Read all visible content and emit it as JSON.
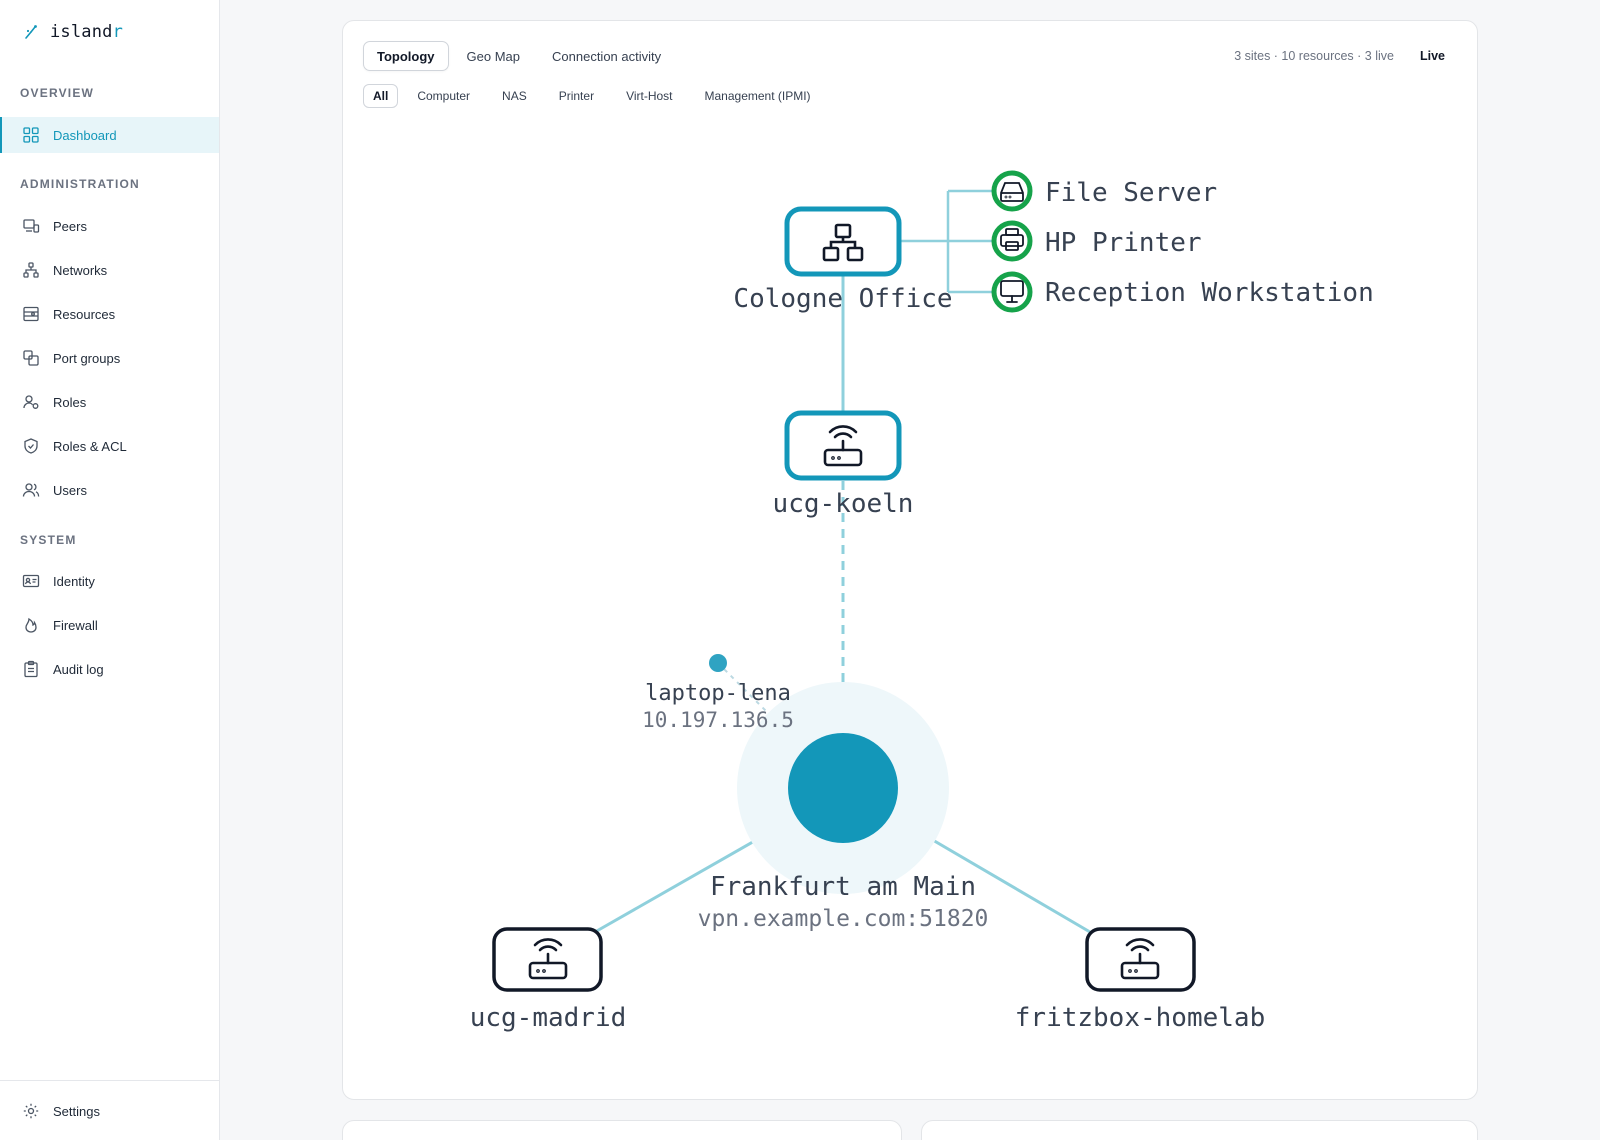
{
  "brand": {
    "name_main": "island",
    "name_accent": "r"
  },
  "sidebar": {
    "sections": [
      {
        "label": "OVERVIEW"
      },
      {
        "label": "ADMINISTRATION"
      },
      {
        "label": "SYSTEM"
      }
    ],
    "items": [
      {
        "label": "Dashboard",
        "icon": "grid-icon",
        "active": true
      },
      {
        "label": "Peers",
        "icon": "peers-icon"
      },
      {
        "label": "Networks",
        "icon": "network-icon"
      },
      {
        "label": "Resources",
        "icon": "resources-icon"
      },
      {
        "label": "Port groups",
        "icon": "port-groups-icon"
      },
      {
        "label": "Roles",
        "icon": "roles-icon"
      },
      {
        "label": "Roles & ACL",
        "icon": "shield-icon"
      },
      {
        "label": "Users",
        "icon": "users-icon"
      },
      {
        "label": "Identity",
        "icon": "id-card-icon"
      },
      {
        "label": "Firewall",
        "icon": "flame-icon"
      },
      {
        "label": "Audit log",
        "icon": "clipboard-icon"
      }
    ],
    "footer": {
      "label": "Settings",
      "icon": "gear-icon"
    }
  },
  "tabs": [
    {
      "label": "Topology",
      "active": true
    },
    {
      "label": "Geo Map"
    },
    {
      "label": "Connection activity"
    }
  ],
  "stats": {
    "summary": "3 sites · 10 resources · 3 live",
    "live_label": "Live"
  },
  "filters": [
    {
      "label": "All",
      "active": true
    },
    {
      "label": "Computer"
    },
    {
      "label": "NAS"
    },
    {
      "label": "Printer"
    },
    {
      "label": "Virt-Host"
    },
    {
      "label": "Management (IPMI)"
    }
  ],
  "topology": {
    "hub": {
      "name": "Frankfurt am Main",
      "endpoint": "vpn.example.com:51820"
    },
    "peer": {
      "name": "laptop-lena",
      "ip": "10.197.136.5"
    },
    "site": {
      "name": "Cologne Office",
      "icon": "sitemap-icon"
    },
    "gateways": [
      {
        "name": "ucg-koeln",
        "icon": "router-icon"
      },
      {
        "name": "ucg-madrid",
        "icon": "router-icon"
      },
      {
        "name": "fritzbox-homelab",
        "icon": "router-icon"
      }
    ],
    "resources": [
      {
        "name": "File Server",
        "icon": "nas-icon",
        "status": "online"
      },
      {
        "name": "HP Printer",
        "icon": "printer-icon",
        "status": "online"
      },
      {
        "name": "Reception Workstation",
        "icon": "monitor-icon",
        "status": "online"
      }
    ],
    "colors": {
      "accent": "#1397b9",
      "link": "#8fd0dc",
      "online": "#16a34a",
      "hub_halo": "#eef7fa"
    }
  }
}
